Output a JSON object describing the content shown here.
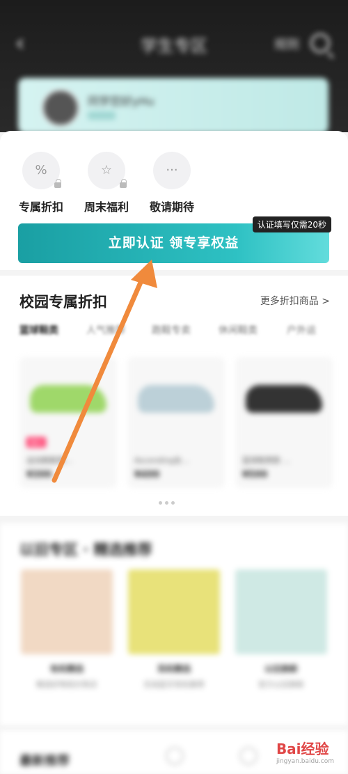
{
  "header": {
    "back": "‹",
    "title": "学生专区",
    "rule_label": "规则"
  },
  "profile": {
    "name": "同学您好yHu"
  },
  "features": [
    {
      "label": "专属折扣",
      "icon": "percent-tag-icon",
      "glyph": "%"
    },
    {
      "label": "周末福利",
      "icon": "star-calendar-icon",
      "glyph": "☆"
    },
    {
      "label": "敬请期待",
      "icon": "more-dots-icon",
      "glyph": "···"
    }
  ],
  "cta": {
    "label": "立即认证 领专享权益",
    "tip": "认证填写仅需20秒"
  },
  "discount": {
    "title": "校园专属折扣",
    "more": "更多折扣商品 >",
    "tabs": [
      "篮球鞋类",
      "人气推荐",
      "跑鞋专卖",
      "休闲鞋类",
      "户外运"
    ],
    "products": [
      {
        "name": "运动跑鞋男…",
        "price": "¥399",
        "badge": "限时",
        "color": "#9fd86a"
      },
      {
        "name": "Ascending女…",
        "price": "¥499",
        "badge": "",
        "color": "#bcd0d8"
      },
      {
        "name": "篮球鞋男款 …",
        "price": "¥599",
        "badge": "",
        "color": "#333"
      }
    ]
  },
  "picks": {
    "title": "以旧专区 · 精选推荐",
    "items": [
      {
        "name": "有机精选",
        "desc": "精选好物低价购买",
        "color": "#f1d9c4"
      },
      {
        "name": "耳机精选",
        "desc": "无线蓝牙耳机推荐",
        "color": "#e8e27a"
      },
      {
        "name": "以旧换新",
        "desc": "官方以旧换新",
        "color": "#cfe9e4"
      }
    ]
  },
  "bottom": {
    "title": "最新推荐"
  },
  "watermark": {
    "logo": "Bai经验",
    "url": "jingyan.baidu.com"
  },
  "colors": {
    "accent": "#21adb0",
    "arrow": "#f08a3c"
  }
}
